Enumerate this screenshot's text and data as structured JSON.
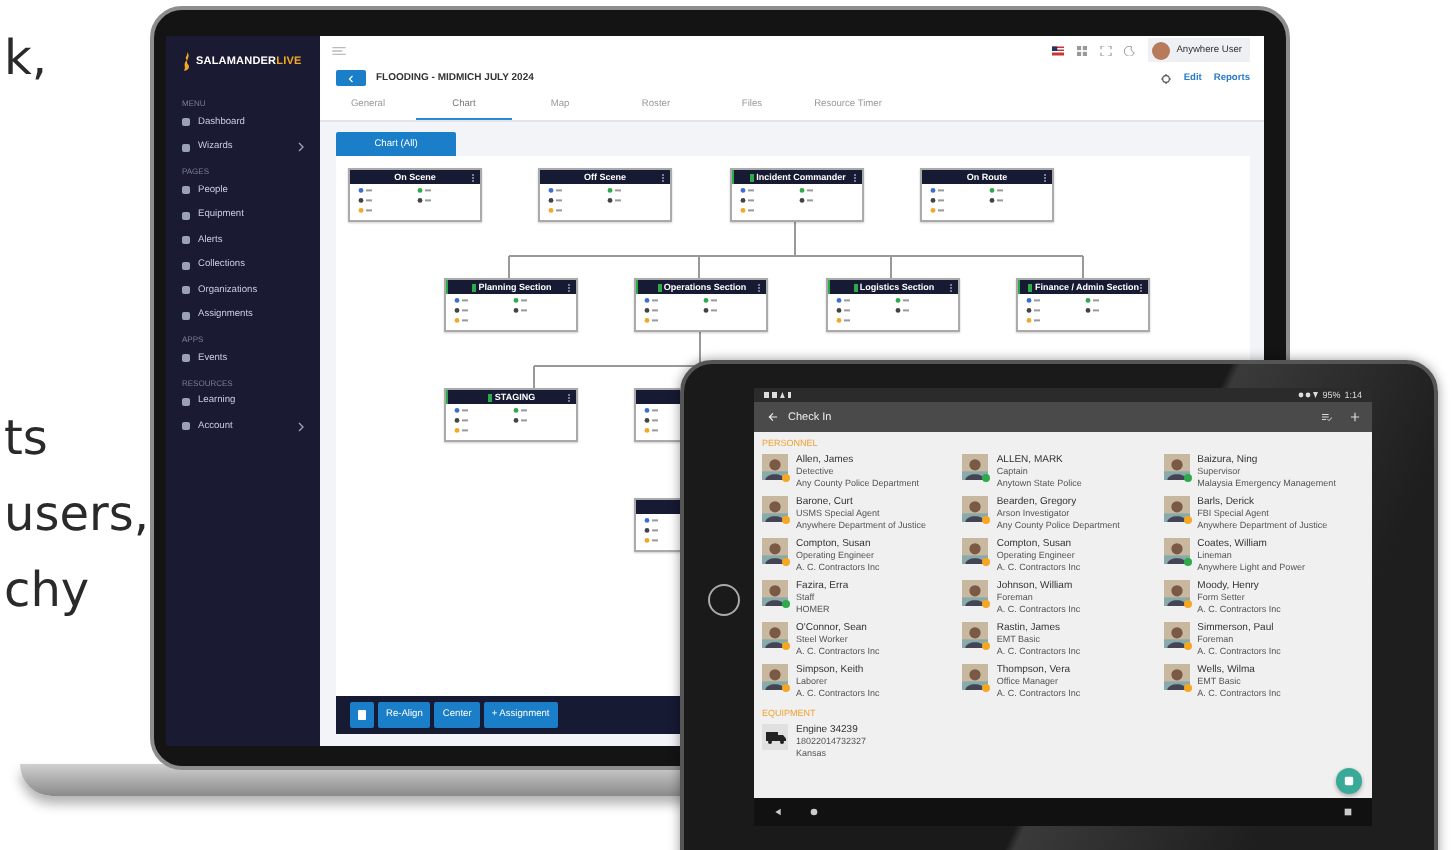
{
  "page_text": [
    "k,",
    "ts",
    "users,",
    "chy"
  ],
  "laptop": {
    "sidebar": {
      "logo": [
        "SALAMANDER",
        "LIVE"
      ],
      "sections": [
        {
          "label": "MENU",
          "items": [
            {
              "label": "Dashboard",
              "submenu": false
            },
            {
              "label": "Wizards",
              "submenu": true
            }
          ]
        },
        {
          "label": "PAGES",
          "items": [
            {
              "label": "People",
              "submenu": false
            },
            {
              "label": "Equipment",
              "submenu": false
            },
            {
              "label": "Alerts",
              "submenu": false
            },
            {
              "label": "Collections",
              "submenu": false
            },
            {
              "label": "Organizations",
              "submenu": false
            },
            {
              "label": "Assignments",
              "submenu": false
            }
          ]
        },
        {
          "label": "APPS",
          "items": [
            {
              "label": "Events",
              "submenu": false
            }
          ]
        },
        {
          "label": "RESOURCES",
          "items": [
            {
              "label": "Learning",
              "submenu": false
            },
            {
              "label": "Account",
              "submenu": true
            }
          ]
        }
      ]
    },
    "user": "Anywhere User",
    "event_title": "FLOODING - MIDMICH JULY 2024",
    "actions": [
      "Edit",
      "Reports"
    ],
    "tabs": [
      {
        "label": "General",
        "selected": false
      },
      {
        "label": "Chart",
        "selected": true
      },
      {
        "label": "Map",
        "selected": false
      },
      {
        "label": "Roster",
        "selected": false
      },
      {
        "label": "Files",
        "selected": false
      },
      {
        "label": "Resource Timer",
        "selected": false
      }
    ],
    "chart_button": "Chart (All)",
    "nodes": [
      {
        "title": "On Scene",
        "active": false
      },
      {
        "title": "Off Scene",
        "active": false
      },
      {
        "title": "Incident Commander",
        "active": true
      },
      {
        "title": "On Route",
        "active": false
      },
      {
        "title": "Planning Section",
        "active": true
      },
      {
        "title": "Operations Section",
        "active": true
      },
      {
        "title": "Logistics Section",
        "active": true
      },
      {
        "title": "Finance / Admin Section",
        "active": true
      },
      {
        "title": "STAGING",
        "active": true
      },
      {
        "active": false
      },
      {
        "active": false
      }
    ],
    "toolbar": [
      "Re-Align",
      "Center",
      "+ Assignment"
    ]
  },
  "tablet": {
    "status": [
      "95%",
      "1:14"
    ],
    "title": "Check In",
    "personnel_label": "PERSONNEL",
    "people": [
      {
        "name": "Allen, James",
        "role": "Detective",
        "org": "Any County Police Department",
        "color": "#f5a623"
      },
      {
        "name": "ALLEN, MARK",
        "role": "Captain",
        "org": "Anytown State Police",
        "color": "#2eaa4a"
      },
      {
        "name": "Baizura, Ning",
        "role": "Supervisor",
        "org": "Malaysia Emergency Management",
        "color": "#2eaa4a"
      },
      {
        "name": "Barone, Curt",
        "role": "USMS Special Agent",
        "org": "Anywhere Department of Justice",
        "color": "#f5a623"
      },
      {
        "name": "Bearden, Gregory",
        "role": "Arson Investigator",
        "org": "Any County Police Department",
        "color": "#f5a623"
      },
      {
        "name": "Barls, Derick",
        "role": "FBI Special Agent",
        "org": "Anywhere Department of Justice",
        "color": "#f5a623"
      },
      {
        "name": "Compton, Susan",
        "role": "Operating Engineer",
        "org": "A. C. Contractors Inc",
        "color": "#f5a623"
      },
      {
        "name": "Compton, Susan",
        "role": "Operating Engineer",
        "org": "A. C. Contractors Inc",
        "color": "#f5a623"
      },
      {
        "name": "Coates, William",
        "role": "Lineman",
        "org": "Anywhere Light and Power",
        "color": "#2eaa4a"
      },
      {
        "name": "Fazira, Erra",
        "role": "Staff",
        "org": "HOMER",
        "color": "#2eaa4a"
      },
      {
        "name": "Johnson, William",
        "role": "Foreman",
        "org": "A. C. Contractors Inc",
        "color": "#f5a623"
      },
      {
        "name": "Moody, Henry",
        "role": "Form Setter",
        "org": "A. C. Contractors Inc",
        "color": "#f5a623"
      },
      {
        "name": "O'Connor, Sean",
        "role": "Steel Worker",
        "org": "A. C. Contractors Inc",
        "color": "#f5a623"
      },
      {
        "name": "Rastin, James",
        "role": "EMT Basic",
        "org": "A. C. Contractors Inc",
        "color": "#f5a623"
      },
      {
        "name": "Simmerson, Paul",
        "role": "Foreman",
        "org": "A. C. Contractors Inc",
        "color": "#f5a623"
      },
      {
        "name": "Simpson, Keith",
        "role": "Laborer",
        "org": "A. C. Contractors Inc",
        "color": "#f5a623"
      },
      {
        "name": "Thompson, Vera",
        "role": "Office Manager",
        "org": "A. C. Contractors Inc",
        "color": "#f5a623"
      },
      {
        "name": "Wells, Wilma",
        "role": "EMT Basic",
        "org": "A. C. Contractors Inc",
        "color": "#f5a623"
      }
    ],
    "equipment_label": "EQUIPMENT",
    "equipment": [
      {
        "name": "Engine 34239",
        "id": "18022014732327",
        "place": "Kansas"
      }
    ]
  }
}
